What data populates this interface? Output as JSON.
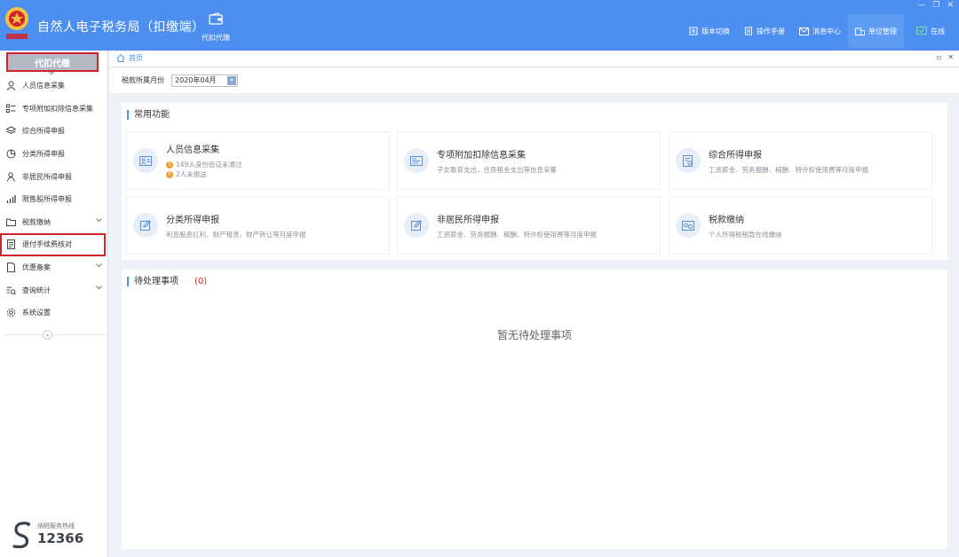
{
  "app": {
    "title": "自然人电子税务局（扣缴端）",
    "logo_text": "中国税务"
  },
  "top_tab": {
    "label": "代扣代缴"
  },
  "toolbar": [
    {
      "label": "版本切换",
      "icon": "switch-icon"
    },
    {
      "label": "操作手册",
      "icon": "manual-icon"
    },
    {
      "label": "消息中心",
      "icon": "mail-icon"
    },
    {
      "label": "单位管理",
      "icon": "building-icon"
    },
    {
      "label": "在线",
      "icon": "monitor-icon"
    }
  ],
  "sidebar": {
    "header": "代扣代缴",
    "items": [
      {
        "label": "人员信息采集",
        "icon": "user-icon"
      },
      {
        "label": "专项附加扣除信息采集",
        "icon": "list-icon"
      },
      {
        "label": "综合所得申报",
        "icon": "layers-icon"
      },
      {
        "label": "分类所得申报",
        "icon": "pie-icon"
      },
      {
        "label": "非居民所得申报",
        "icon": "person-icon"
      },
      {
        "label": "限售股所得申报",
        "icon": "bar-chart-icon"
      },
      {
        "label": "税款缴纳",
        "icon": "folder-icon"
      },
      {
        "label": "退付手续费核对",
        "icon": "doc-icon"
      },
      {
        "label": "优惠备案",
        "icon": "file-icon"
      },
      {
        "label": "查询统计",
        "icon": "search-list-icon"
      },
      {
        "label": "系统设置",
        "icon": "gear-icon"
      }
    ],
    "hotline": {
      "caption": "纳税服务热线",
      "number": "12366"
    }
  },
  "breadcrumb": {
    "label": "首页"
  },
  "filter": {
    "label": "税款所属月份",
    "value": "2020年04月"
  },
  "common": {
    "title": "常用功能",
    "cards": [
      {
        "title": "人员信息采集",
        "warn1": "149人身份验证未通过",
        "warn2": "2人未报送"
      },
      {
        "title": "专项附加扣除信息采集",
        "desc": "子女教育支出，住房租金支出等信息采集"
      },
      {
        "title": "综合所得申报",
        "desc": "工资薪金、劳务报酬、稿酬、特许权使用费等月度申报"
      },
      {
        "title": "分类所得申报",
        "desc": "利息股息红利、财产租赁、财产转让等月度申报"
      },
      {
        "title": "非居民所得申报",
        "desc": "工资薪金、劳务报酬、稿酬、特许权使用费等月度申报"
      },
      {
        "title": "税款缴纳",
        "desc": "个人所得税税款在线缴纳"
      }
    ]
  },
  "pending": {
    "title": "待处理事项",
    "count": "(0)",
    "empty": "暂无待处理事项"
  },
  "colors": {
    "header": "#4c8ff0",
    "highlight": "#d1242b",
    "warn": "#f0a030"
  }
}
